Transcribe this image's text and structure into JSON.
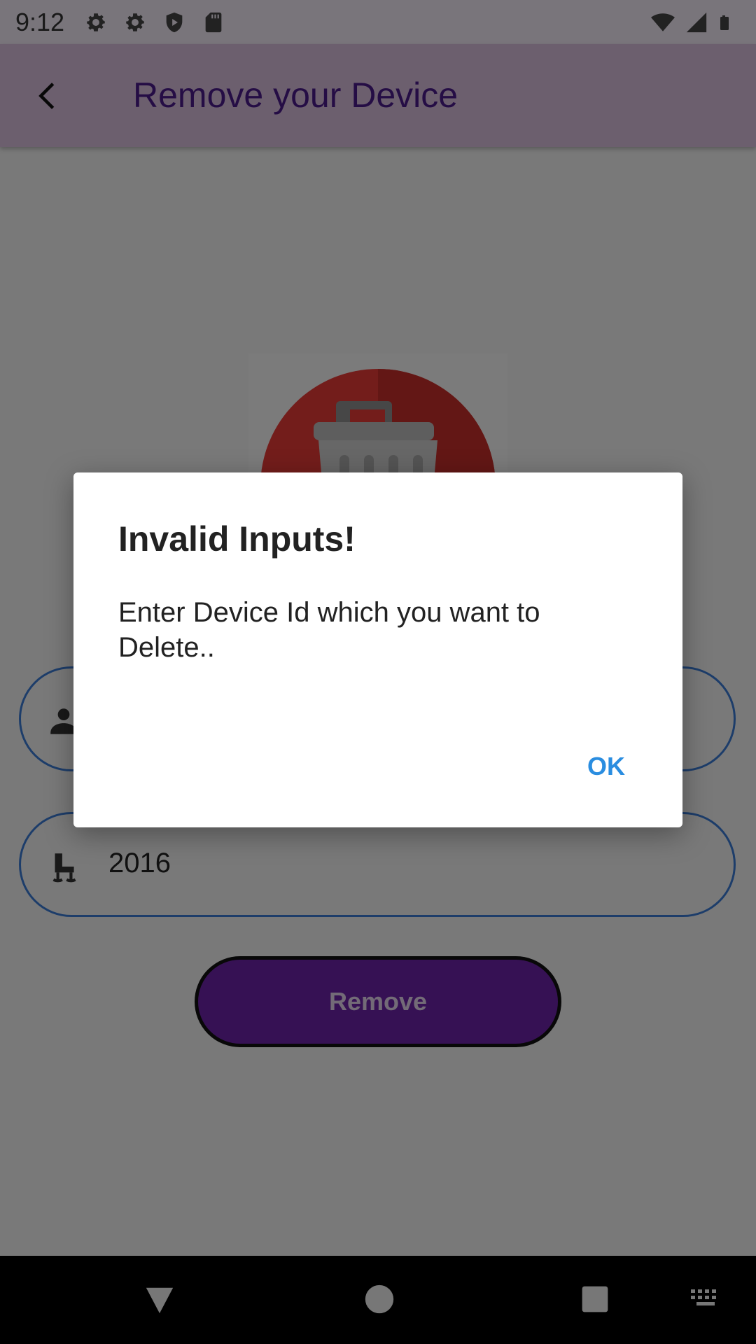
{
  "status_bar": {
    "time": "9:12",
    "icons": [
      "settings-icon",
      "settings-icon",
      "shield-play-icon",
      "sd-card-icon"
    ],
    "right_icons": [
      "wifi-icon",
      "signal-icon",
      "battery-icon"
    ]
  },
  "app_bar": {
    "title": "Remove your Device",
    "back_icon": "chevron-left-icon"
  },
  "form": {
    "device_id_value": "",
    "year_value": "2016",
    "remove_label": "Remove"
  },
  "dialog": {
    "title": "Invalid Inputs!",
    "message": "Enter Device Id which you want to Delete..",
    "ok_label": "OK"
  },
  "colors": {
    "app_bar": "#d8bfdc",
    "title": "#4a1a8a",
    "field_border": "#3a7bd5",
    "remove_button": "#6d23a8",
    "ok_text": "#2a8de0",
    "trash_circle": "#e63a36"
  }
}
